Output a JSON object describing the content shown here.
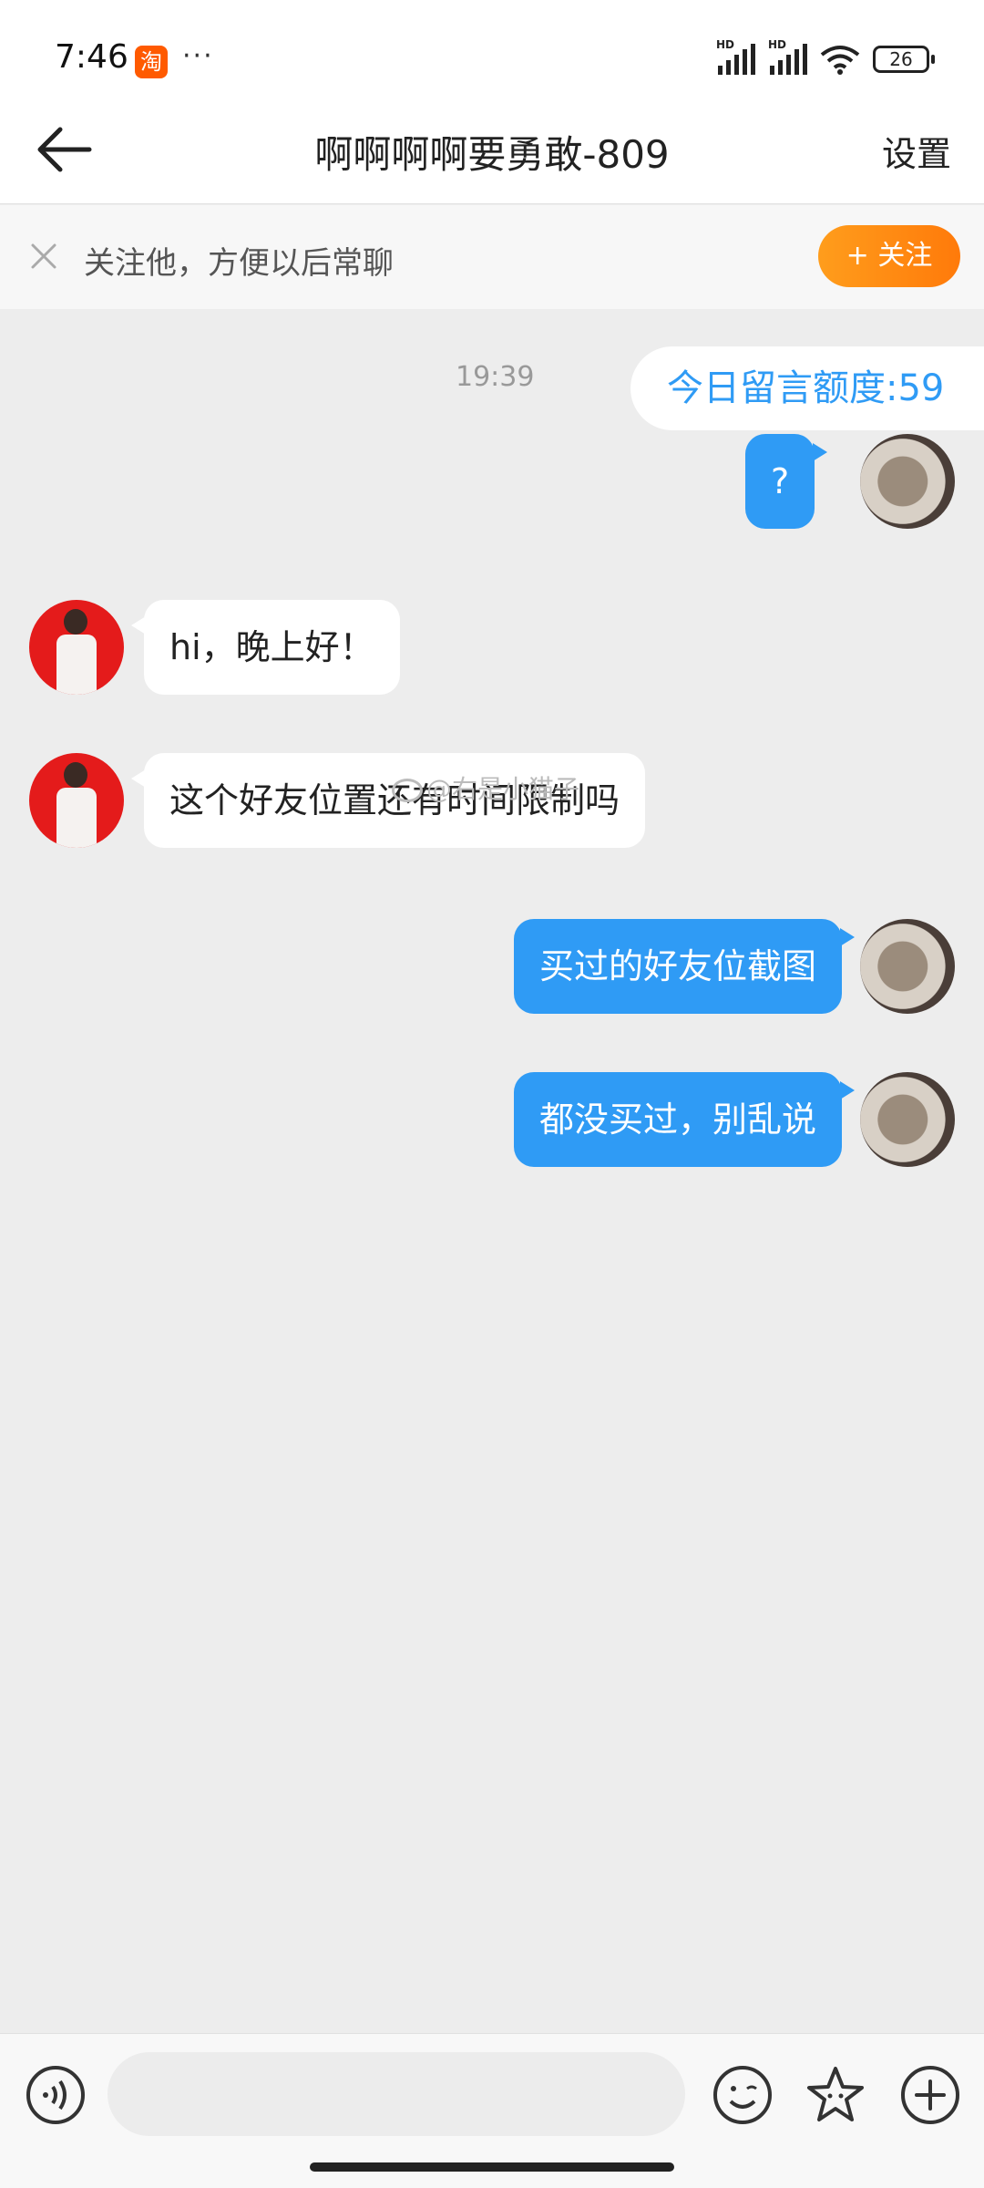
{
  "status_bar": {
    "time": "7:46",
    "app_badge": "淘",
    "overflow": "···",
    "signal1_tag": "HD",
    "signal2_tag": "HD",
    "battery": "26"
  },
  "header": {
    "back_icon": "arrow-left-icon",
    "title": "啊啊啊啊要勇敢-809",
    "settings_label": "设置"
  },
  "follow_bar": {
    "close_icon": "close-icon",
    "text": "关注他，方便以后常聊",
    "follow_button": "+ 关注"
  },
  "chat": {
    "timestamp": "19:39",
    "quota": "今日留言额度:59",
    "messages": [
      {
        "side": "out",
        "text": "?"
      },
      {
        "side": "in",
        "text": "hi，晚上好！"
      },
      {
        "side": "in",
        "text": "这个好友位置还有时间限制吗"
      },
      {
        "side": "out",
        "text": "买过的好友位截图"
      },
      {
        "side": "out",
        "text": "都没买过，别乱说"
      }
    ],
    "watermark": "@右是小猫子"
  },
  "input_bar": {
    "voice_icon": "voice-icon",
    "input_value": "",
    "input_placeholder": "",
    "emoji_icon": "emoji-icon",
    "sticker_icon": "star-sticker-icon",
    "plus_icon": "plus-icon"
  },
  "colors": {
    "accent_blue": "#2f9bf5",
    "follow_orange": "#ff8a12",
    "chat_bg": "#ededed"
  }
}
